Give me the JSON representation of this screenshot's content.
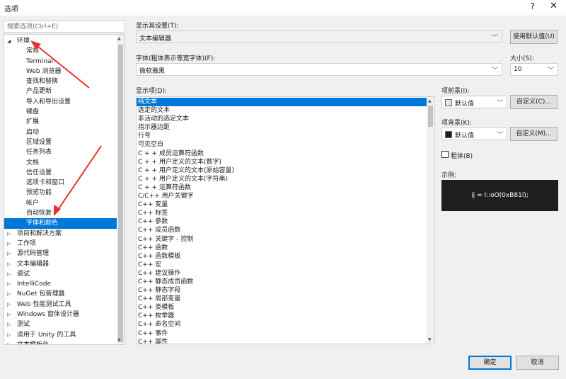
{
  "window": {
    "title": "选项",
    "help": "?",
    "close": "✕"
  },
  "search": {
    "placeholder": "搜索选项(Ctrl+E)"
  },
  "tree": [
    {
      "label": "环境",
      "indent": 0,
      "arrow": "◢"
    },
    {
      "label": "常规",
      "indent": 1
    },
    {
      "label": "Terminal",
      "indent": 1
    },
    {
      "label": "Web 浏览器",
      "indent": 1
    },
    {
      "label": "查找和替换",
      "indent": 1
    },
    {
      "label": "产品更新",
      "indent": 1
    },
    {
      "label": "导入和导出设置",
      "indent": 1
    },
    {
      "label": "键盘",
      "indent": 1
    },
    {
      "label": "扩展",
      "indent": 1
    },
    {
      "label": "启动",
      "indent": 1
    },
    {
      "label": "区域设置",
      "indent": 1
    },
    {
      "label": "任务列表",
      "indent": 1
    },
    {
      "label": "文档",
      "indent": 1
    },
    {
      "label": "信任设置",
      "indent": 1
    },
    {
      "label": "选项卡和窗口",
      "indent": 1
    },
    {
      "label": "预览功能",
      "indent": 1
    },
    {
      "label": "帐户",
      "indent": 1
    },
    {
      "label": "自动恢复",
      "indent": 1
    },
    {
      "label": "字体和颜色",
      "indent": 1,
      "selected": true
    },
    {
      "label": "项目和解决方案",
      "indent": 0,
      "arrow": "▷"
    },
    {
      "label": "工作项",
      "indent": 0,
      "arrow": "▷"
    },
    {
      "label": "源代码管理",
      "indent": 0,
      "arrow": "▷"
    },
    {
      "label": "文本编辑器",
      "indent": 0,
      "arrow": "▷"
    },
    {
      "label": "调试",
      "indent": 0,
      "arrow": "▷"
    },
    {
      "label": "IntelliCode",
      "indent": 0,
      "arrow": "▷"
    },
    {
      "label": "NuGet 包管理器",
      "indent": 0,
      "arrow": "▷"
    },
    {
      "label": "Web 性能测试工具",
      "indent": 0,
      "arrow": "▷"
    },
    {
      "label": "Windows 窗体设计器",
      "indent": 0,
      "arrow": "▷"
    },
    {
      "label": "测试",
      "indent": 0,
      "arrow": "▷"
    },
    {
      "label": "适用于 Unity 的工具",
      "indent": 0,
      "arrow": "▷"
    },
    {
      "label": "文本模板化",
      "indent": 0,
      "arrow": "▷"
    }
  ],
  "show_settings": {
    "label": "显示其设置(T):",
    "value": "文本编辑器",
    "default_button": "使用默认值(U)"
  },
  "font": {
    "label": "字体(粗体表示等宽字体)(F):",
    "value": "微软雅黑"
  },
  "size": {
    "label": "大小(S):",
    "value": "10"
  },
  "display_items": {
    "label": "显示项(D):",
    "items": [
      "纯文本",
      "选定的文本",
      "非活动的选定文本",
      "指示器边距",
      "行号",
      "可见空白",
      "C + + 成员运算符函数",
      "C + + 用户定义的文本(数字)",
      "C + + 用户定义的文本(原始容量)",
      "C + + 用户定义的文本(字符串)",
      "C + + 运算符函数",
      "C/C++ 用户关键字",
      "C++ 变量",
      "C++ 标签",
      "C++ 参数",
      "C++ 成员函数",
      "C++ 关键字 - 控制",
      "C++ 函数",
      "C++ 函数模板",
      "C++ 宏",
      "C++ 建议操作",
      "C++ 静态成员函数",
      "C++ 静态字段",
      "C++ 局部变量",
      "C++ 类模板",
      "C++ 枚举器",
      "C++ 命名空间",
      "C++ 事件",
      "C++ 属性"
    ],
    "selected_index": 0
  },
  "foreground": {
    "label": "项前景(I):",
    "value": "默认值",
    "swatch_color": "#e6e6e6",
    "custom_button": "自定义(C)..."
  },
  "background": {
    "label": "项背景(K):",
    "value": "默认值",
    "swatch_color": "#1e1e1e",
    "custom_button": "自定义(M)..."
  },
  "bold": {
    "label": "粗体(B)"
  },
  "sample": {
    "label": "示例:",
    "text": "ij = I::oO(0xB81l);"
  },
  "footer": {
    "ok": "确定",
    "cancel": "取消"
  },
  "colors": {
    "selection": "#0078d7",
    "annotation_arrow": "#e8312d"
  }
}
